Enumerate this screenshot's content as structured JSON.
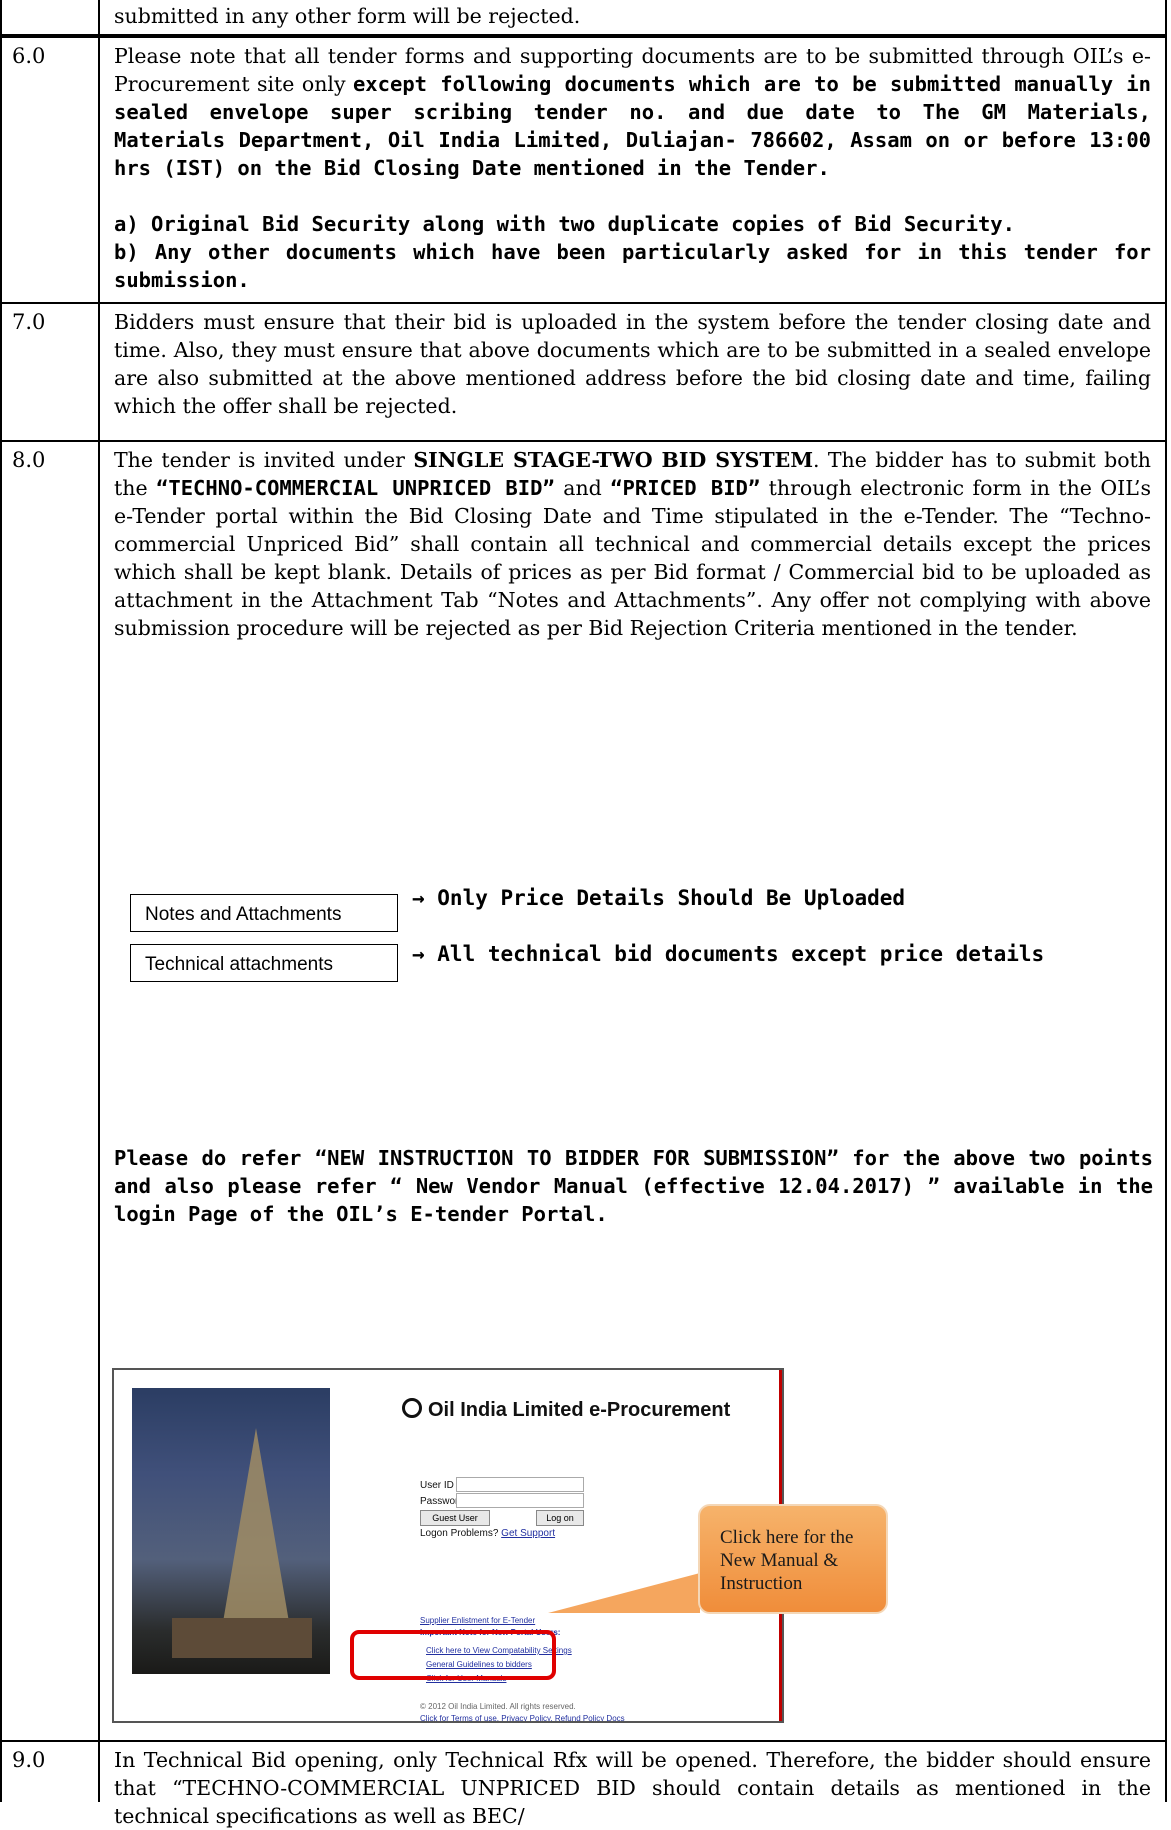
{
  "row_5_tail": {
    "text": "submitted in any other form will be rejected."
  },
  "row_6": {
    "number": "6.0",
    "intro": "Please note that all tender forms and supporting documents are to be submitted through OIL’s e-Procurement site only",
    "intro_bold": "except following documents which are to be submitted manually in sealed envelope super scribing tender no. and due date to The GM Materials, Materials Department, Oil India Limited, Duliajan- 786602, Assam on or before 13:00 hrs (IST) on the Bid Closing Date mentioned in the Tender.",
    "item_a": "a) Original Bid Security along with two duplicate copies of Bid Security.",
    "item_b": "b) Any other documents which have been particularly asked for in this tender for submission."
  },
  "row_7": {
    "number": "7.0",
    "text": "Bidders must ensure that their bid is uploaded in the system before the tender closing date and time. Also, they must ensure that above documents which are to be submitted in a sealed envelope are also submitted at the above mentioned address before the bid closing date and time, failing which the offer shall be rejected."
  },
  "row_8": {
    "number": "8.0",
    "p1_a": "The tender is invited under",
    "p1_b": "SINGLE STAGE-TWO BID SYSTEM",
    "p1_c": ". The bidder has to submit both the",
    "p1_d": "“TECHNO-COMMERCIAL UNPRICED BID”",
    "p1_e": "and",
    "p1_f": "“PRICED BID”",
    "p1_g": "through electronic form in the OIL’s e-Tender portal within the Bid Closing Date and Time stipulated in the e-Tender. The “Techno-commercial Unpriced Bid” shall contain all technical and commercial details except the prices which shall be kept blank. Details of prices as per Bid format / Commercial bid to be uploaded as attachment in the Attachment Tab “Notes and Attachments”. Any offer not complying with above submission procedure will be rejected as per Bid Rejection Criteria mentioned in the tender.",
    "tab1_label": "Notes and Attachments",
    "tab1_note": "→ Only Price Details Should Be Uploaded",
    "tab2_label": "Technical attachments",
    "tab2_note": "→ All technical bid documents except price details",
    "refer": "Please do refer “NEW INSTRUCTION TO BIDDER FOR SUBMISSION” for the above two points and also please refer “ New Vendor Manual (effective 12.04.2017) ” available in the login Page of the OIL’s E-tender Portal."
  },
  "portal": {
    "logo_text": "Oil India Limited e-Procurement",
    "user_id_label": "User ID",
    "password_label": "Password",
    "required_mark": "*",
    "guest_button": "Guest User",
    "logon_button": "Log on",
    "logon_problems": "Logon Problems?",
    "get_support": "Get Support",
    "links": [
      "Supplier Enlistment for E-Tender",
      "Important Note for New Portal Users:",
      "Click here to View Compatability Settings",
      "General Guidelines to bidders",
      "Click for User Manuals"
    ],
    "copyright": "© 2012 Oil India Limited. All rights reserved.",
    "terms": "Click for Terms of use, Privacy Policy, Refund Policy Docs"
  },
  "callout": {
    "text": "Click here for the New Manual & Instruction"
  },
  "row_9": {
    "number": "9.0",
    "text": "In Technical Bid opening, only Technical Rfx will be opened. Therefore, the bidder should ensure that “TECHNO-COMMERCIAL UNPRICED BID should contain details as mentioned in the technical specifications as well as BEC/"
  }
}
